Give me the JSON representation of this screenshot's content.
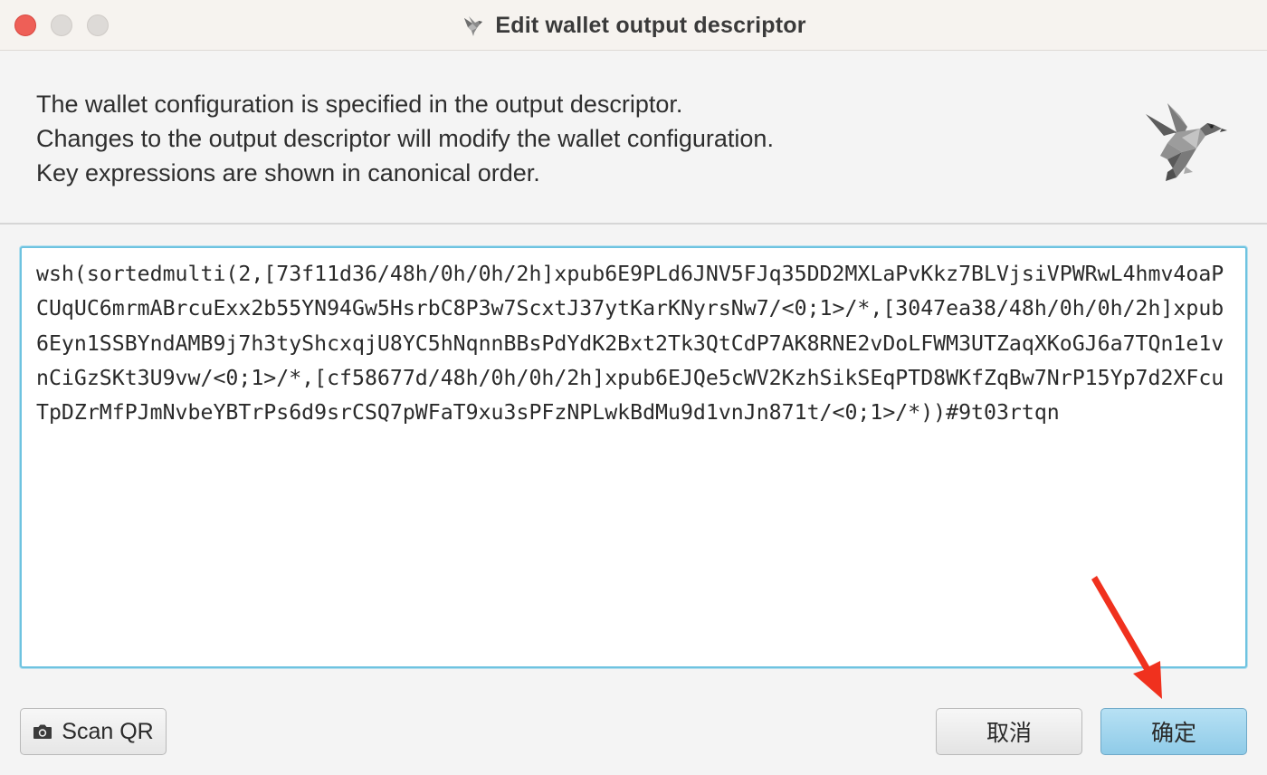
{
  "window": {
    "title": "Edit wallet output descriptor",
    "title_icon": "sparrow-bird-icon"
  },
  "header": {
    "lines": [
      "The wallet configuration is specified in the output descriptor.",
      "Changes to the output descriptor will modify the wallet configuration.",
      "Key expressions are shown in canonical order."
    ],
    "logo": "sparrow-bird-logo"
  },
  "descriptor": {
    "value": "wsh(sortedmulti(2,[73f11d36/48h/0h/0h/2h]xpub6E9PLd6JNV5FJq35DD2MXLaPvKkz7BLVjsiVPWRwL4hmv4oaPCUqUC6mrmABrcuExx2b55YN94Gw5HsrbC8P3w7ScxtJ37ytKarKNyrsNw7/<0;1>/*,[3047ea38/48h/0h/0h/2h]xpub6Eyn1SSBYndAMB9j7h3tyShcxqjU8YC5hNqnnBBsPdYdK2Bxt2Tk3QtCdP7AK8RNE2vDoLFWM3UTZaqXKoGJ6a7TQn1e1vnCiGzSKt3U9vw/<0;1>/*,[cf58677d/48h/0h/0h/2h]xpub6EJQe5cWV2KzhSikSEqPTD8WKfZqBw7NrP15Yp7d2XFcuTpDZrMfPJmNvbeYBTrPs6d9srCSQ7pWFaT9xu3sPFzNPLwkBdMu9d1vnJn871t/<0;1>/*))#9t03rtqn"
  },
  "buttons": {
    "scan_qr": "Scan QR",
    "scan_qr_icon": "camera-icon",
    "cancel": "取消",
    "ok": "确定"
  },
  "colors": {
    "ok_button": "#9fd3ec",
    "focus_border": "#6ec3e0",
    "close_button": "#ee5f57",
    "annotation_arrow": "#f0311e"
  }
}
